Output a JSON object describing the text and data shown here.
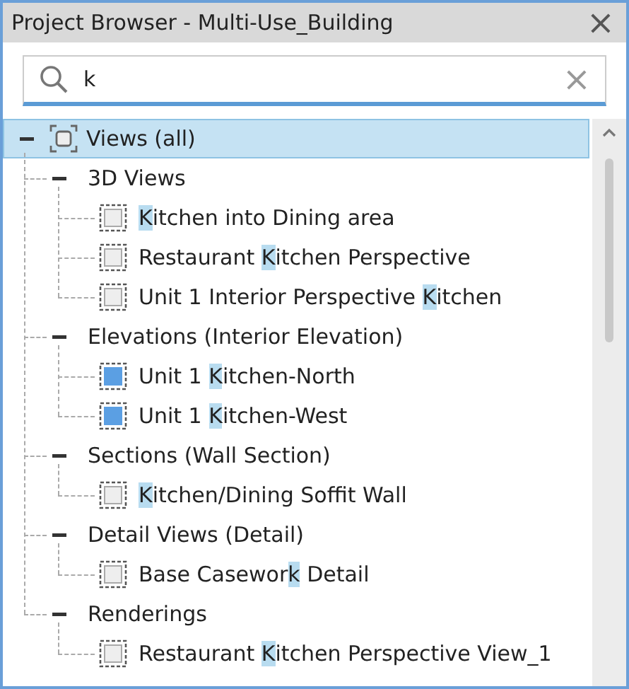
{
  "window": {
    "title": "Project Browser - Multi-Use_Building",
    "close": "×"
  },
  "search": {
    "value": "k",
    "clear": "×"
  },
  "tree": {
    "label": "Views (all)",
    "selected": true,
    "expanded": true,
    "children": [
      {
        "label": "3D Views",
        "expanded": true,
        "children": [
          {
            "kind": "plain",
            "segments": [
              {
                "text": "K",
                "highlighted": true
              },
              {
                "text": "itchen into Dining area",
                "highlighted": false
              }
            ]
          },
          {
            "kind": "plain",
            "segments": [
              {
                "text": "Restaurant ",
                "highlighted": false
              },
              {
                "text": "K",
                "highlighted": true
              },
              {
                "text": "itchen Perspective",
                "highlighted": false
              }
            ]
          },
          {
            "kind": "plain",
            "segments": [
              {
                "text": "Unit 1 Interior Perspective ",
                "highlighted": false
              },
              {
                "text": "K",
                "highlighted": true
              },
              {
                "text": "itchen",
                "highlighted": false
              }
            ]
          }
        ]
      },
      {
        "label": "Elevations (Interior Elevation)",
        "expanded": true,
        "children": [
          {
            "kind": "elevation",
            "segments": [
              {
                "text": "Unit 1 ",
                "highlighted": false
              },
              {
                "text": "K",
                "highlighted": true
              },
              {
                "text": "itchen-North",
                "highlighted": false
              }
            ]
          },
          {
            "kind": "elevation",
            "segments": [
              {
                "text": "Unit 1 ",
                "highlighted": false
              },
              {
                "text": "K",
                "highlighted": true
              },
              {
                "text": "itchen-West",
                "highlighted": false
              }
            ]
          }
        ]
      },
      {
        "label": "Sections (Wall Section)",
        "expanded": true,
        "children": [
          {
            "kind": "plain",
            "segments": [
              {
                "text": "K",
                "highlighted": true
              },
              {
                "text": "itchen/Dining Soffit Wall",
                "highlighted": false
              }
            ]
          }
        ]
      },
      {
        "label": "Detail Views (Detail)",
        "expanded": true,
        "children": [
          {
            "kind": "plain",
            "segments": [
              {
                "text": "Base Casewor",
                "highlighted": false
              },
              {
                "text": "k",
                "highlighted": true
              },
              {
                "text": " Detail",
                "highlighted": false
              }
            ]
          }
        ]
      },
      {
        "label": "Renderings",
        "expanded": true,
        "children": [
          {
            "kind": "plain",
            "segments": [
              {
                "text": "Restaurant ",
                "highlighted": false
              },
              {
                "text": "K",
                "highlighted": true
              },
              {
                "text": "itchen Perspective View_1",
                "highlighted": false
              }
            ]
          }
        ]
      }
    ]
  }
}
